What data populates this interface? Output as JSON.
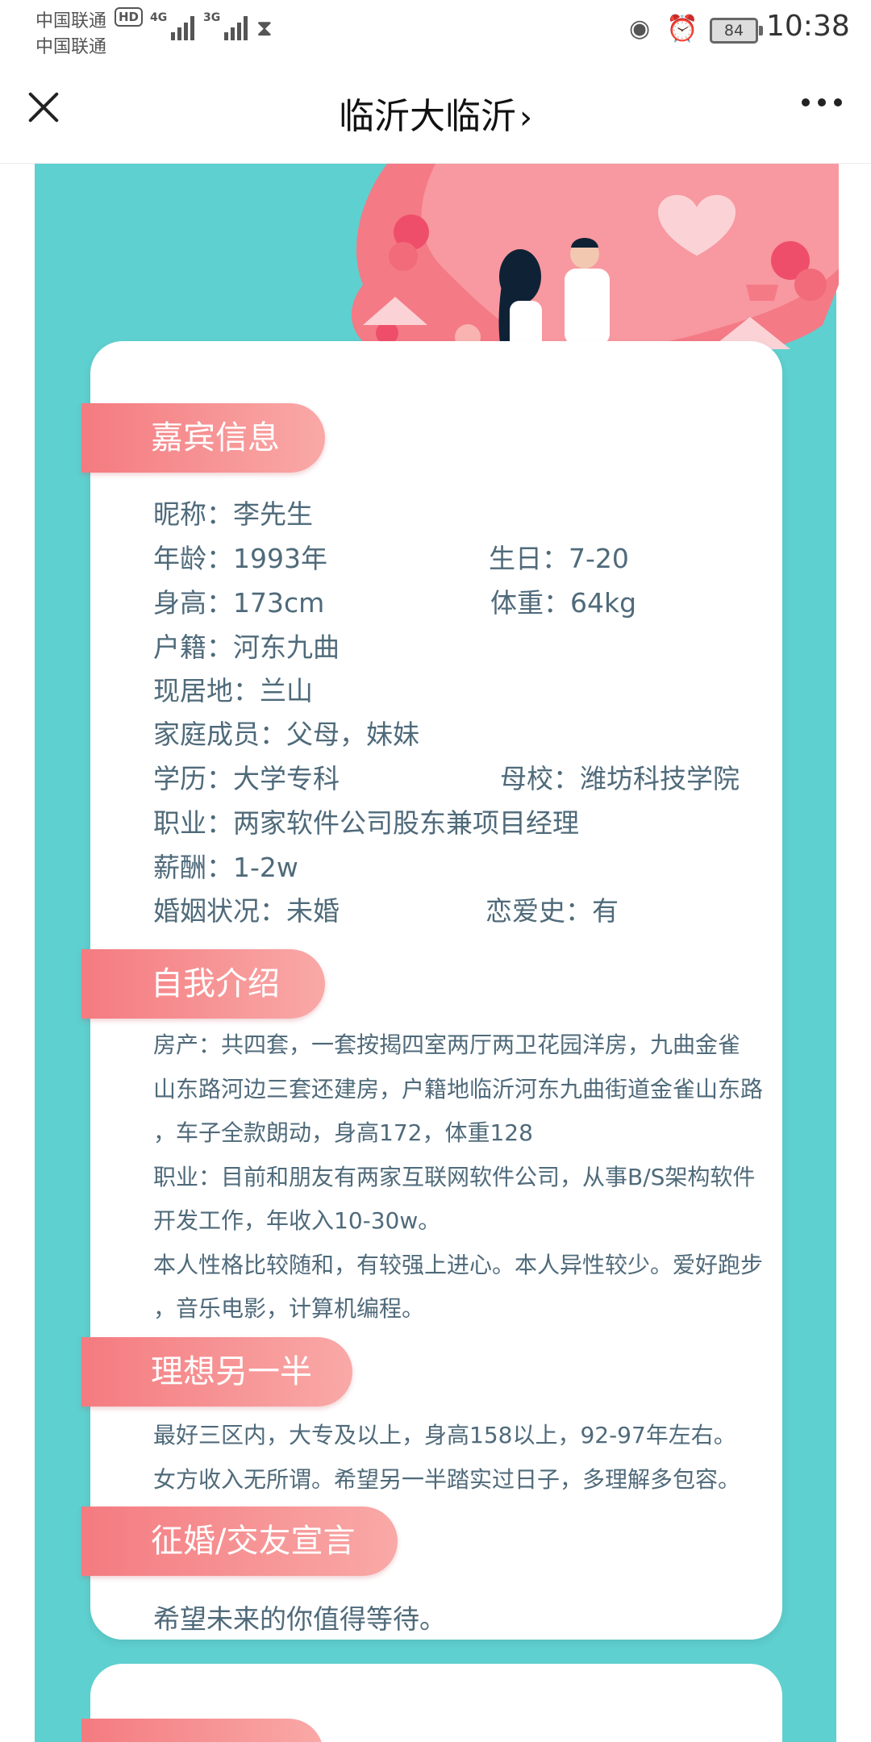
{
  "status_bar": {
    "carrier1": "中国联通",
    "carrier2": "中国联通",
    "hd": "HD",
    "net1": "4G",
    "net2": "3G",
    "battery": "84",
    "time": "10:38"
  },
  "nav": {
    "title": "临沂大临沂",
    "chevron": "›"
  },
  "profile": {
    "section_guest": "嘉宾信息",
    "nickname": "昵称：李先生",
    "age": "年龄：1993年",
    "birthday": "生日：7-20",
    "height": "身高：173cm",
    "weight": "体重：64kg",
    "hukou": "户籍：河东九曲",
    "residence": "现居地：兰山",
    "family": "家庭成员：父母，妹妹",
    "education": "学历：大学专科",
    "school": "母校：潍坊科技学院",
    "job": "职业：两家软件公司股东兼项目经理",
    "salary": "薪酬：1-2w",
    "marital": "婚姻状况：未婚",
    "love_history": "恋爱史：有"
  },
  "intro": {
    "section": "自我介绍",
    "lines": [
      "房产：共四套，一套按揭四室两厅两卫花园洋房，九曲金雀",
      "山东路河边三套还建房，户籍地临沂河东九曲街道金雀山东路",
      "，车子全款朗动，身高172，体重128",
      "职业：目前和朋友有两家互联网软件公司，从事B/S架构软件",
      "开发工作，年收入10-30w。",
      "本人性格比较随和，有较强上进心。本人异性较少。爱好跑步",
      "，音乐电影，计算机编程。"
    ]
  },
  "ideal": {
    "section": "理想另一半",
    "lines": [
      "最好三区内，大专及以上，身高158以上，92-97年左右。",
      "女方收入无所谓。希望另一半踏实过日子，多理解多包容。"
    ]
  },
  "declaration": {
    "section": "征婚/交友宣言",
    "text": "希望未来的你值得等待。"
  }
}
